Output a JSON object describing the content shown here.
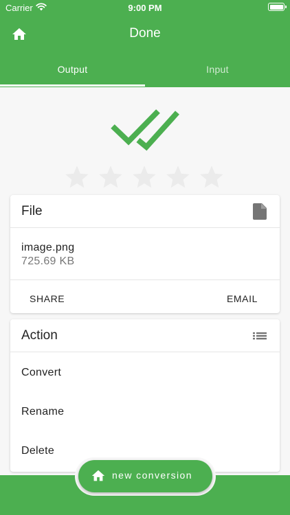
{
  "status_bar": {
    "carrier": "Carrier",
    "time": "9:00 PM"
  },
  "app_bar": {
    "title": "Done"
  },
  "tabs": [
    {
      "label": "Output"
    },
    {
      "label": "Input"
    }
  ],
  "rating": {
    "max": 5,
    "value": 0
  },
  "file_card": {
    "title": "File",
    "file_name": "image.png",
    "file_size": "725.69 KB",
    "share_label": "SHARE",
    "email_label": "EMAIL"
  },
  "action_card": {
    "title": "Action",
    "items": [
      {
        "label": "Convert"
      },
      {
        "label": "Rename"
      },
      {
        "label": "Delete"
      }
    ]
  },
  "fab": {
    "label": "new conversion"
  },
  "colors": {
    "primary": "#4caf50",
    "star_empty": "#ebebeb",
    "background": "#f7f7f7"
  }
}
